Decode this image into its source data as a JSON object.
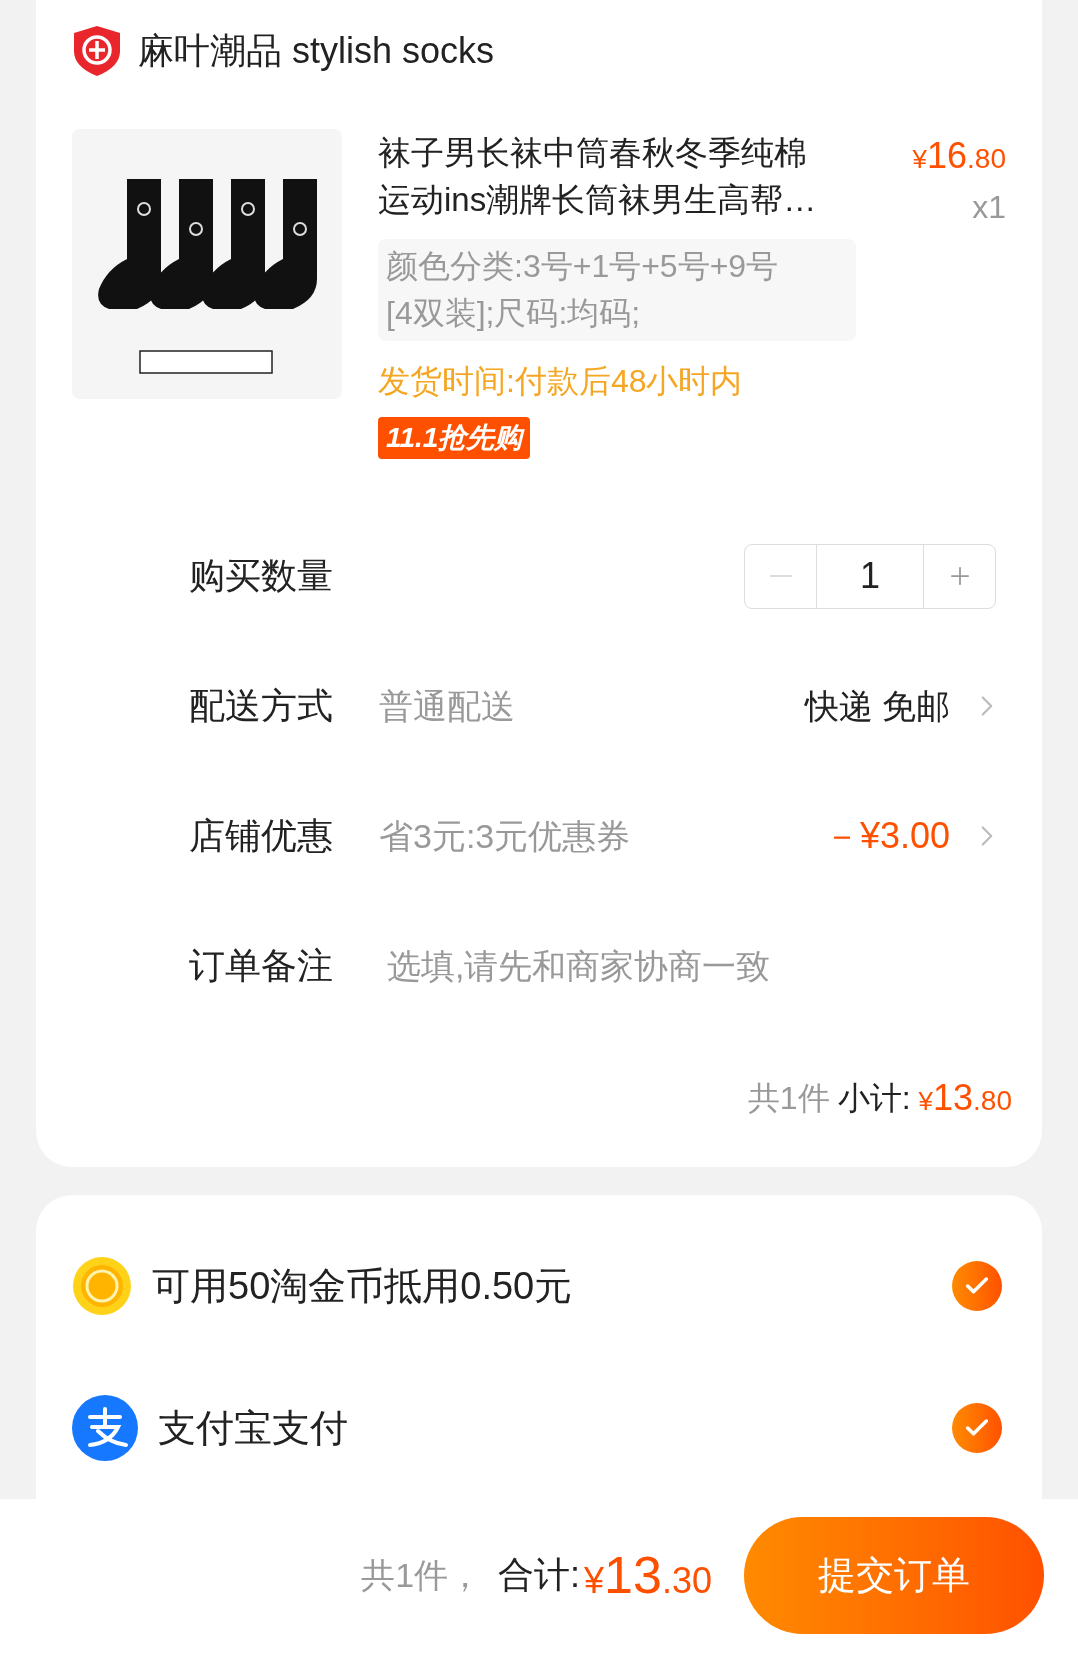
{
  "store": {
    "name": "麻叶潮品 stylish socks"
  },
  "product": {
    "title_lines": [
      "袜子男长袜中筒春秋冬季纯棉",
      "运动ins潮牌长筒袜男生高帮…"
    ],
    "price": {
      "symbol": "¥",
      "integer": "16",
      "decimal": ".80"
    },
    "quantity": "x1",
    "spec_lines": [
      "颜色分类:3号+1号+5号+9号",
      "[4双装];尺码:均码;"
    ],
    "shipping_time": "发货时间:付款后48小时内",
    "badge": "11.1抢先购"
  },
  "rows": [
    {
      "kind": "quantity",
      "label": "购买数量",
      "value": "1",
      "decrement_disabled": true
    },
    {
      "kind": "option",
      "label": "配送方式",
      "detail": "普通配送",
      "value": "快递 免邮",
      "highlight": false
    },
    {
      "kind": "option",
      "label": "店铺优惠",
      "detail": "省3元:3元优惠券",
      "value": "－¥3.00",
      "highlight": true
    },
    {
      "kind": "note",
      "label": "订单备注",
      "placeholder": "选填,请先和商家协商一致"
    }
  ],
  "subtotal": {
    "count": "共1件",
    "label": "小计:",
    "symbol": "¥",
    "integer": "13",
    "decimal": ".80"
  },
  "payments": [
    {
      "kind": "coins",
      "label": "可用50淘金币抵用0.50元",
      "checked": true
    },
    {
      "kind": "alipay",
      "label": "支付宝支付",
      "checked": true
    }
  ],
  "footer": {
    "count": "共1件，",
    "label": "合计:",
    "symbol": "¥",
    "integer": "13",
    "decimal": ".30",
    "submit": "提交订单"
  }
}
